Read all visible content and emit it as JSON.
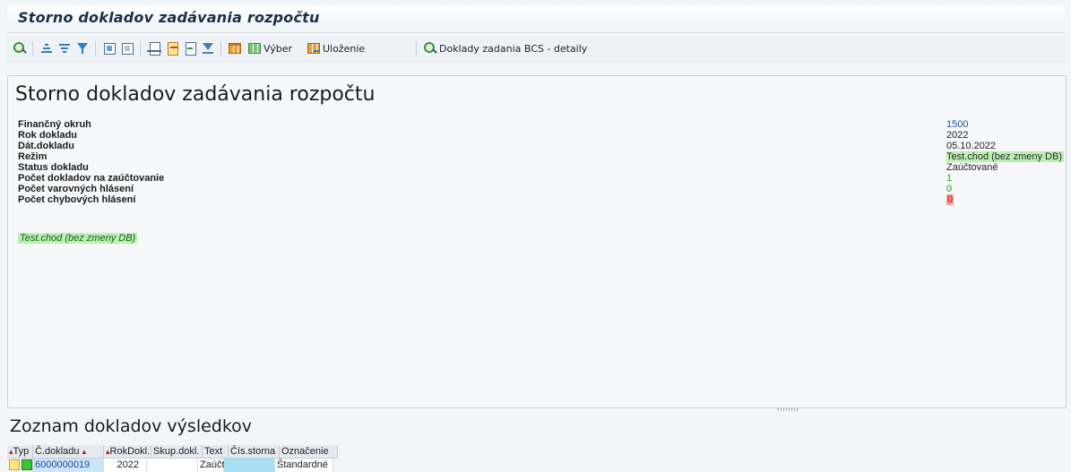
{
  "window": {
    "title": "Storno dokladov zadávania rozpočtu"
  },
  "toolbar": {
    "vyber_label": "Výber",
    "ulozenie_label": "Uloženie",
    "detaily_label": "Doklady zadania BCS - detaily"
  },
  "header": {
    "title": "Storno dokladov zadávania rozpočtu",
    "fields": [
      {
        "label": "Finančný okruh",
        "value": "1500"
      },
      {
        "label": "Rok dokladu",
        "value": "2022"
      },
      {
        "label": "Dát.dokladu",
        "value": "05.10.2022"
      },
      {
        "label": "Režim",
        "value": "Test.chod (bez zmeny DB)"
      },
      {
        "label": "Status dokladu",
        "value": "Zaúčtované"
      },
      {
        "label": "Počet dokladov na zaúčtovanie",
        "value": "1"
      },
      {
        "label": "Počet varovných hlásení",
        "value": "0"
      },
      {
        "label": "Počet chybových hlásení",
        "value": "0"
      }
    ],
    "note": "Test.chod (bez zmeny DB)"
  },
  "results": {
    "title": "Zoznam dokladov výsledkov",
    "columns": [
      "Typ",
      "Č.dokladu",
      "RokDokl.",
      "Skup.dokl.",
      "Text",
      "Čís.storna",
      "Označenie"
    ],
    "rows": [
      {
        "doc_number": "6000000019",
        "year": "2022",
        "group": "",
        "text": "Zaúčt.",
        "storno_no": "",
        "designation": "Štandardné"
      }
    ]
  },
  "colors": {
    "highlight_green": "#b9f0b0",
    "error_red": "#f2a0a0",
    "link_blue": "#1f4f99"
  }
}
